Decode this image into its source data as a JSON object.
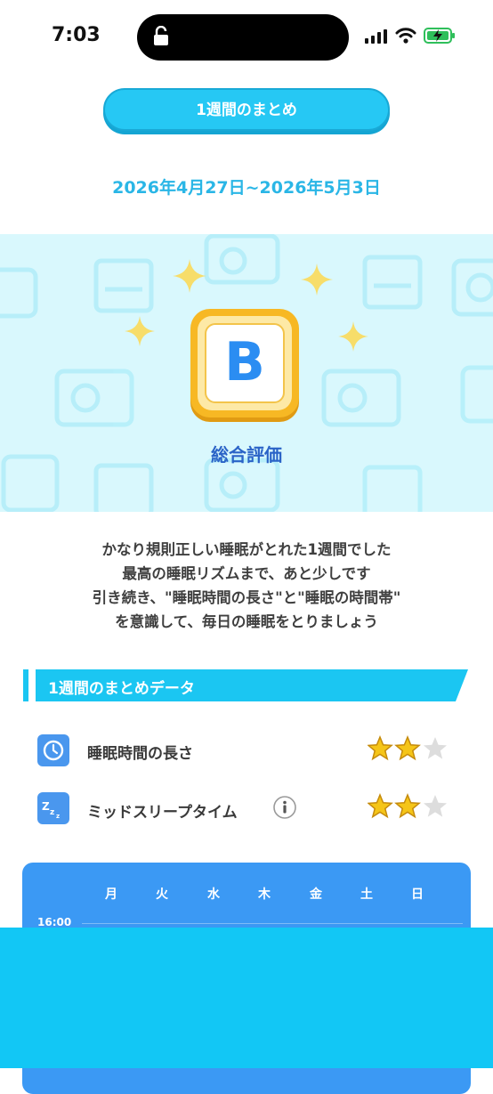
{
  "status_bar": {
    "time": "7:03"
  },
  "header": {
    "title": "1週間のまとめ",
    "date_range": "2026年4月27日~2026年5月3日"
  },
  "grade": {
    "letter": "B",
    "label": "総合評価"
  },
  "message_lines": [
    "かなり規則正しい睡眠がとれた1週間でした",
    "最高の睡眠リズムまで、あと少しです",
    "引き続き、\"睡眠時間の長さ\"と\"睡眠の時間帯\"",
    "を意識して、毎日の睡眠をとりましょう"
  ],
  "summary": {
    "section_title": "1週間のまとめデータ",
    "metrics": [
      {
        "label": "睡眠時間の長さ",
        "icon": "clock-icon",
        "stars_filled": 2,
        "stars_total": 3
      },
      {
        "label": "ミッドスリープタイム",
        "icon": "zzz-icon",
        "stars_filled": 2,
        "stars_total": 3
      }
    ]
  },
  "calendar": {
    "days": [
      "月",
      "火",
      "水",
      "木",
      "金",
      "土",
      "日"
    ],
    "first_hour": "16:00"
  },
  "colors": {
    "accent": "#26c8f4",
    "grade_text": "#2b8df2",
    "calendar_bg": "#3b99f4",
    "star_filled": "#f5c518",
    "star_empty": "#dddddd"
  }
}
